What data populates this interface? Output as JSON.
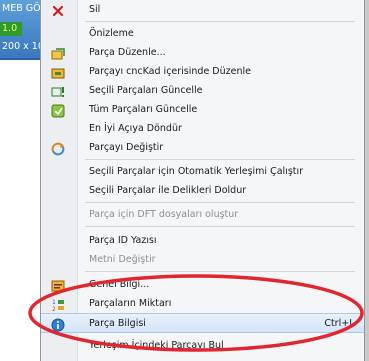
{
  "background": {
    "line1": "MEB GÖ",
    "line2": "1.0",
    "line3": "200 x 10"
  },
  "menu": {
    "items": [
      {
        "label": "Sil",
        "icon": "close-icon",
        "disabled": false
      },
      {
        "label": "Önizleme",
        "icon": "",
        "disabled": false
      },
      {
        "label": "Parça Düzenle...",
        "icon": "part-edit-icon",
        "disabled": false
      },
      {
        "label": "Parçayı cncKad içerisinde Düzenle",
        "icon": "cnckad-edit-icon",
        "disabled": false
      },
      {
        "label": "Seçili Parçaları Güncelle",
        "icon": "update-selected-icon",
        "disabled": false
      },
      {
        "label": "Tüm Parçaları Güncelle",
        "icon": "update-all-icon",
        "disabled": false
      },
      {
        "label": "En İyi Açıya Döndür",
        "icon": "",
        "disabled": false
      },
      {
        "label": "Parçayı Değiştir",
        "icon": "replace-part-icon",
        "disabled": false
      },
      {
        "label": "Seçili Parçalar için Otomatik Yerleşimi Çalıştır",
        "icon": "",
        "disabled": false
      },
      {
        "label": "Seçili Parçalar ile Delikleri Doldur",
        "icon": "",
        "disabled": false
      },
      {
        "label": "Parça için DFT dosyaları oluştur",
        "icon": "",
        "disabled": true
      },
      {
        "label": "Parça ID Yazısı",
        "icon": "",
        "disabled": false
      },
      {
        "label": "Metni Değiştir",
        "icon": "",
        "disabled": true
      },
      {
        "label": "Genel Bilgi...",
        "icon": "general-info-icon",
        "disabled": false
      },
      {
        "label": "Parçaların Miktarı",
        "icon": "quantity-icon",
        "disabled": false
      },
      {
        "label": "Parça Bilgisi",
        "icon": "info-icon",
        "disabled": false,
        "shortcut": "Ctrl+I",
        "highlighted": true
      },
      {
        "label": "Yerleşim İçindeki Parçayı Bul",
        "icon": "",
        "disabled": false
      }
    ]
  },
  "colors": {
    "highlight": "#d3e5f8",
    "annotation": "#e0262e",
    "header_blue": "#3a78bf",
    "green_cell": "#2f9a2f"
  }
}
